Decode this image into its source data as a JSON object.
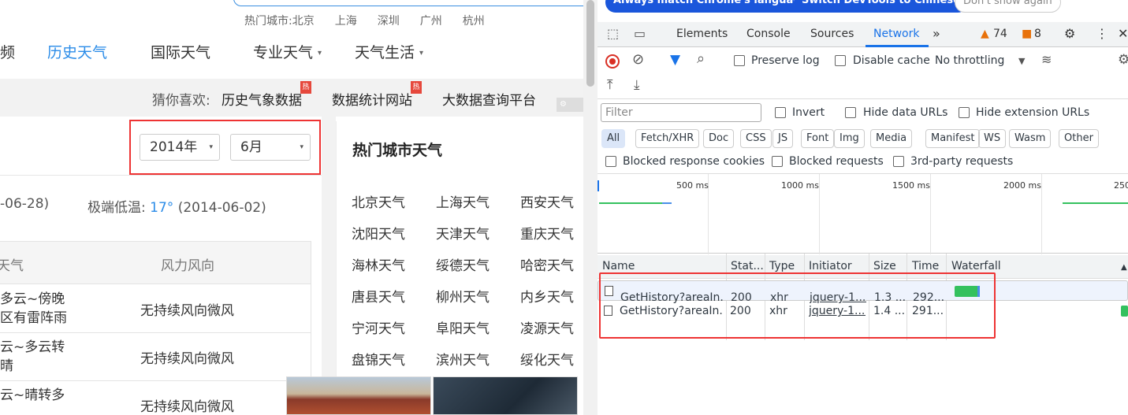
{
  "site": {
    "hot_cities_label": "热门城市:北京",
    "hot_cities": [
      "上海",
      "深圳",
      "广州",
      "杭州"
    ],
    "nav": {
      "item_partial": "频",
      "history": "历史天气",
      "international": "国际天气",
      "professional": "专业天气",
      "life": "天气生活",
      "caret": "▾"
    },
    "promo": {
      "label": "猜你喜欢:",
      "links": [
        "历史气象数据",
        "数据统计网站",
        "大数据查询平台"
      ],
      "hot_tag": "热"
    },
    "year_select": {
      "value": "2014年",
      "arrow": "▾"
    },
    "month_select": {
      "value": "6月",
      "arrow": "▾"
    },
    "max_temp_partial": "-06-28)",
    "min_temp_label": "极端低温:",
    "min_temp_value": "17°",
    "min_temp_date": "(2014-06-02)",
    "table": {
      "col_weather": "天气",
      "col_wind": "风力风向",
      "rows": [
        {
          "weather_l1": "多云~傍晚",
          "weather_l2": "区有雷阵雨",
          "wind": "无持续风向微风"
        },
        {
          "weather_l1": "云~多云转",
          "weather_l2": "晴",
          "wind": "无持续风向微风"
        },
        {
          "weather_l1": "云~晴转多",
          "weather_l2": "",
          "wind": "无持续风向微风"
        }
      ]
    },
    "hot_weather": {
      "title": "热门城市天气",
      "cities": [
        [
          "北京天气",
          "上海天气",
          "西安天气"
        ],
        [
          "沈阳天气",
          "天津天气",
          "重庆天气"
        ],
        [
          "海林天气",
          "绥德天气",
          "哈密天气"
        ],
        [
          "唐县天气",
          "柳州天气",
          "内乡天气"
        ],
        [
          "宁河天气",
          "阜阳天气",
          "凌源天气"
        ],
        [
          "盘锦天气",
          "滨州天气",
          "绥化天气"
        ]
      ]
    }
  },
  "devtools": {
    "banner": {
      "match_language": "Always match Chrome's language",
      "switch_chinese": "Switch DevTools to Chinese",
      "dont_show": "Don't show again"
    },
    "tabs": [
      "Elements",
      "Console",
      "Sources",
      "Network"
    ],
    "active_tab": "Network",
    "more_tabs": "»",
    "warnings_count": "74",
    "issues_count": "8",
    "toolbar": {
      "preserve_log": "Preserve log",
      "disable_cache": "Disable cache",
      "throttling": "No throttling"
    },
    "filter": {
      "placeholder": "Filter",
      "invert": "Invert",
      "hide_data_urls": "Hide data URLs",
      "hide_extension_urls": "Hide extension URLs"
    },
    "type_chips": [
      "All",
      "Fetch/XHR",
      "Doc",
      "CSS",
      "JS",
      "Font",
      "Img",
      "Media",
      "Manifest",
      "WS",
      "Wasm",
      "Other"
    ],
    "active_chip": "All",
    "blocked": {
      "cookies": "Blocked response cookies",
      "requests": "Blocked requests",
      "third_party": "3rd-party requests"
    },
    "overview_ticks": [
      "500 ms",
      "1000 ms",
      "1500 ms",
      "2000 ms",
      "250"
    ],
    "columns": [
      "Name",
      "Stat...",
      "Type",
      "Initiator",
      "Size",
      "Time",
      "Waterfall"
    ],
    "requests": [
      {
        "name": "GetHistory?areaIn...",
        "status": "200",
        "type": "xhr",
        "initiator": "jquery-1....",
        "size": "1.3 ...",
        "time": "292..."
      },
      {
        "name": "GetHistory?areaIn...",
        "status": "200",
        "type": "xhr",
        "initiator": "jquery-1....",
        "size": "1.4 ...",
        "time": "291..."
      }
    ],
    "colors": {
      "accent": "#1a73e8",
      "highlight": "#e33333",
      "waterfall": "#34c15e"
    }
  }
}
